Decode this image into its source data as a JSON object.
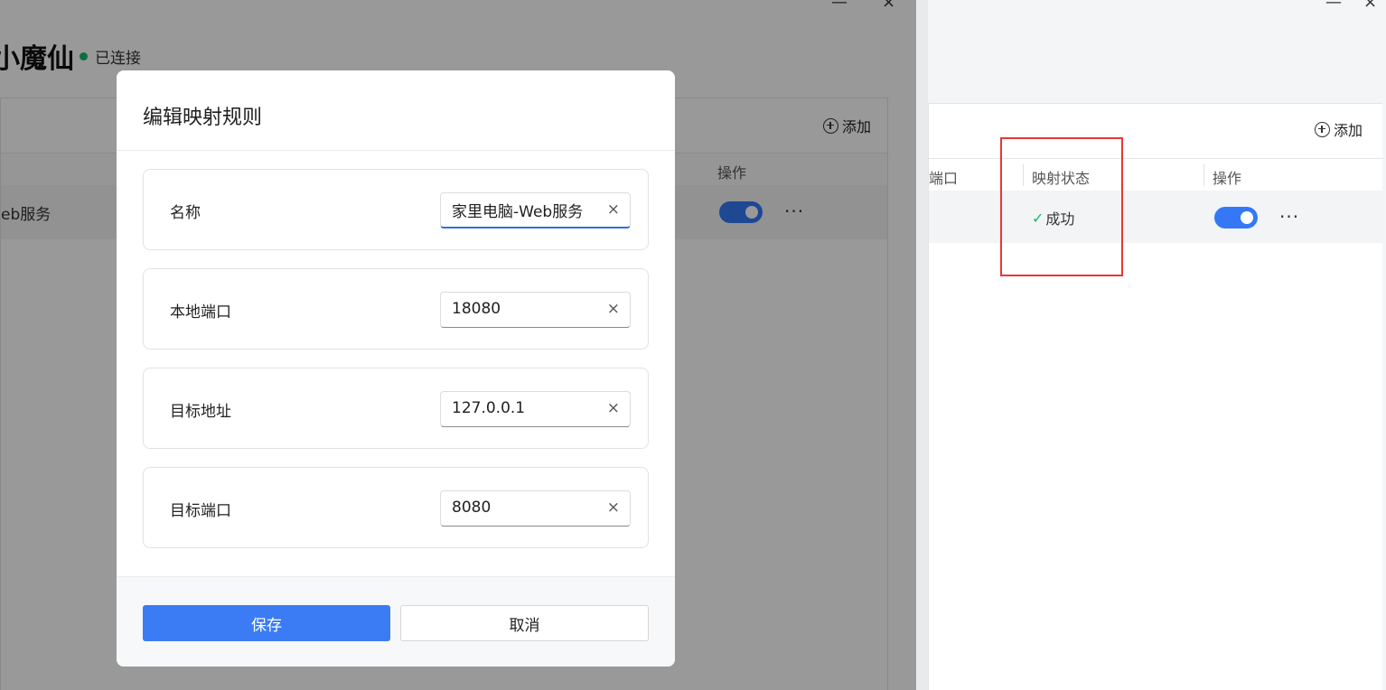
{
  "right_window": {
    "minimize_glyph": "—",
    "close_glyph": "×",
    "add_label": "添加",
    "columns": {
      "port_partial": "端口",
      "status": "映射状态",
      "actions": "操作"
    },
    "row": {
      "status_text": "成功",
      "enabled": true,
      "more_glyph": "···"
    }
  },
  "left_window": {
    "title_partial": "小魔仙",
    "connection_status": "已连接",
    "minimize_glyph": "—",
    "close_glyph": "×",
    "add_label": "添加",
    "columns": {
      "actions": "操作"
    },
    "row": {
      "name_partial": "eb服务",
      "enabled": true,
      "more_glyph": "···"
    }
  },
  "modal": {
    "title": "编辑映射规则",
    "fields": [
      {
        "label": "名称",
        "value": "家里电脑-Web服务"
      },
      {
        "label": "本地端口",
        "value": "18080"
      },
      {
        "label": "目标地址",
        "value": "127.0.0.1"
      },
      {
        "label": "目标端口",
        "value": "8080"
      }
    ],
    "clear_glyph": "×",
    "save_label": "保存",
    "cancel_label": "取消"
  },
  "colors": {
    "accent": "#3b7cf5",
    "success": "#18b86a",
    "highlight": "#e53935"
  }
}
